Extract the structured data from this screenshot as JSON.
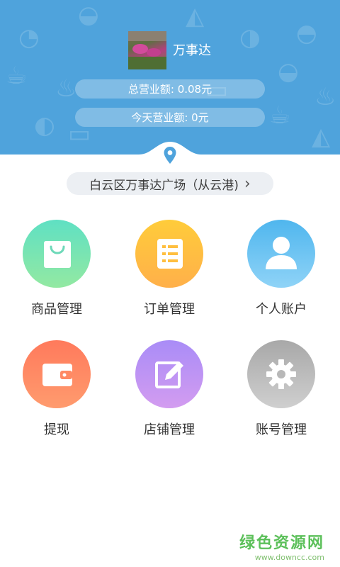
{
  "header": {
    "shop_name": "万事达",
    "total_revenue": "总营业额: 0.08元",
    "today_revenue": "今天营业额: 0元",
    "background_color": "#4fa3dc",
    "decor_icons": [
      "burger-icon",
      "cup-icon",
      "cake-icon",
      "pizza-icon",
      "bowl-icon",
      "cart-icon",
      "steak-icon",
      "chef-hat-icon"
    ]
  },
  "location": {
    "text": "白云区万事达广场（从云港)",
    "chevron": "›"
  },
  "menu": [
    {
      "label": "商品管理",
      "icon": "shopping-bag-icon",
      "colors": [
        "#5fe0c3",
        "#93e9a2"
      ]
    },
    {
      "label": "订单管理",
      "icon": "order-list-icon",
      "colors": [
        "#ffcc3a",
        "#ffb04a"
      ]
    },
    {
      "label": "个人账户",
      "icon": "person-icon",
      "colors": [
        "#4fb6ee",
        "#8fd3f7"
      ]
    },
    {
      "label": "提现",
      "icon": "wallet-icon",
      "colors": [
        "#ff7a5c",
        "#ff9b6e"
      ]
    },
    {
      "label": "店铺管理",
      "icon": "edit-icon",
      "colors": [
        "#a98cf7",
        "#d39cf0"
      ]
    },
    {
      "label": "账号管理",
      "icon": "gear-icon",
      "colors": [
        "#a8a8a8",
        "#cfcfcf"
      ]
    }
  ],
  "watermark": {
    "line1": "绿色资源网",
    "line2": "www.downcc.com"
  }
}
